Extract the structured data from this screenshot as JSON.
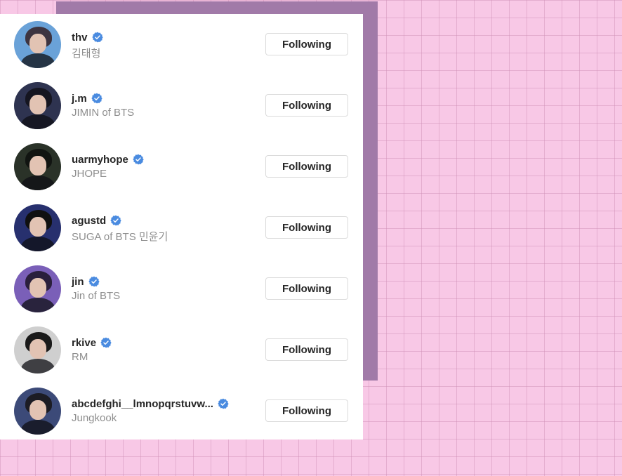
{
  "following": [
    {
      "username": "thv",
      "full_name": "김태형",
      "verified": true,
      "button_label": "Following",
      "avatar_bg": "#6aa2d8",
      "avatar_hair": "#3d3440"
    },
    {
      "username": "j.m",
      "full_name": "JIMIN of BTS",
      "verified": true,
      "button_label": "Following",
      "avatar_bg": "#2e3350",
      "avatar_hair": "#151520"
    },
    {
      "username": "uarmyhope",
      "full_name": "JHOPE",
      "verified": true,
      "button_label": "Following",
      "avatar_bg": "#2a3228",
      "avatar_hair": "#111411"
    },
    {
      "username": "agustd",
      "full_name": "SUGA of BTS 민윤기",
      "verified": true,
      "button_label": "Following",
      "avatar_bg": "#27306e",
      "avatar_hair": "#101010"
    },
    {
      "username": "jin",
      "full_name": "Jin of BTS",
      "verified": true,
      "button_label": "Following",
      "avatar_bg": "#7a5fb8",
      "avatar_hair": "#2a1f3c"
    },
    {
      "username": "rkive",
      "full_name": "RM",
      "verified": true,
      "button_label": "Following",
      "avatar_bg": "#cfcfcf",
      "avatar_hair": "#1a1a1a"
    },
    {
      "username": "abcdefghi__lmnopqrstuvw...",
      "full_name": "Jungkook",
      "verified": true,
      "button_label": "Following",
      "avatar_bg": "#3c4a78",
      "avatar_hair": "#1c1c24"
    }
  ],
  "colors": {
    "verified_badge": "#4a8be0",
    "username_text": "#262626",
    "fullname_text": "#8e8e8e",
    "button_border": "#dbdbdb",
    "background_pink": "#f8c8e6",
    "shadow_purple": "#a17aa8"
  },
  "icons": {
    "verified": "verified-badge-icon"
  }
}
